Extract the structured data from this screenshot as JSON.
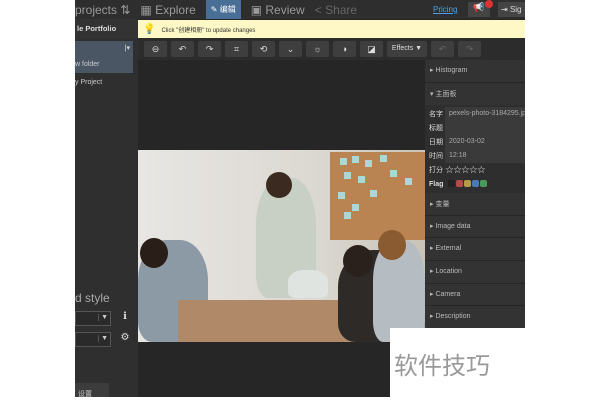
{
  "topbar": {
    "projects": "projects ⇅",
    "explore": "Explore",
    "edit": "编辑",
    "review": "Review",
    "share": "Share",
    "pricing": "Pricing",
    "sign": "Sig"
  },
  "notice": "Click \"创建相册\" to update changes",
  "sidebar": {
    "title": "le Portfolio",
    "folder": "w folder",
    "project": "y Project",
    "style": "d style",
    "settings": "设置"
  },
  "toolbar": {
    "effects": "Effects ▼"
  },
  "panel": {
    "histogram": "Histogram",
    "main": "主面板",
    "fields": [
      {
        "k": "名字",
        "v": "pexels-photo-3184295.jpg"
      },
      {
        "k": "标题",
        "v": ""
      },
      {
        "k": "日期",
        "v": "2020-03-02"
      },
      {
        "k": "时间",
        "v": "12:18"
      }
    ],
    "rating_label": "打分",
    "rating": 0,
    "stars": "☆☆☆☆☆",
    "flag_label": "Flag",
    "flags": [
      "#222222",
      "#b54a4a",
      "#b59a4a",
      "#4a7ab5",
      "#4a9a5a"
    ],
    "sections": [
      "变量",
      "Image data",
      "External",
      "Location",
      "Camera",
      "Description"
    ]
  },
  "watermark": "软件技巧"
}
